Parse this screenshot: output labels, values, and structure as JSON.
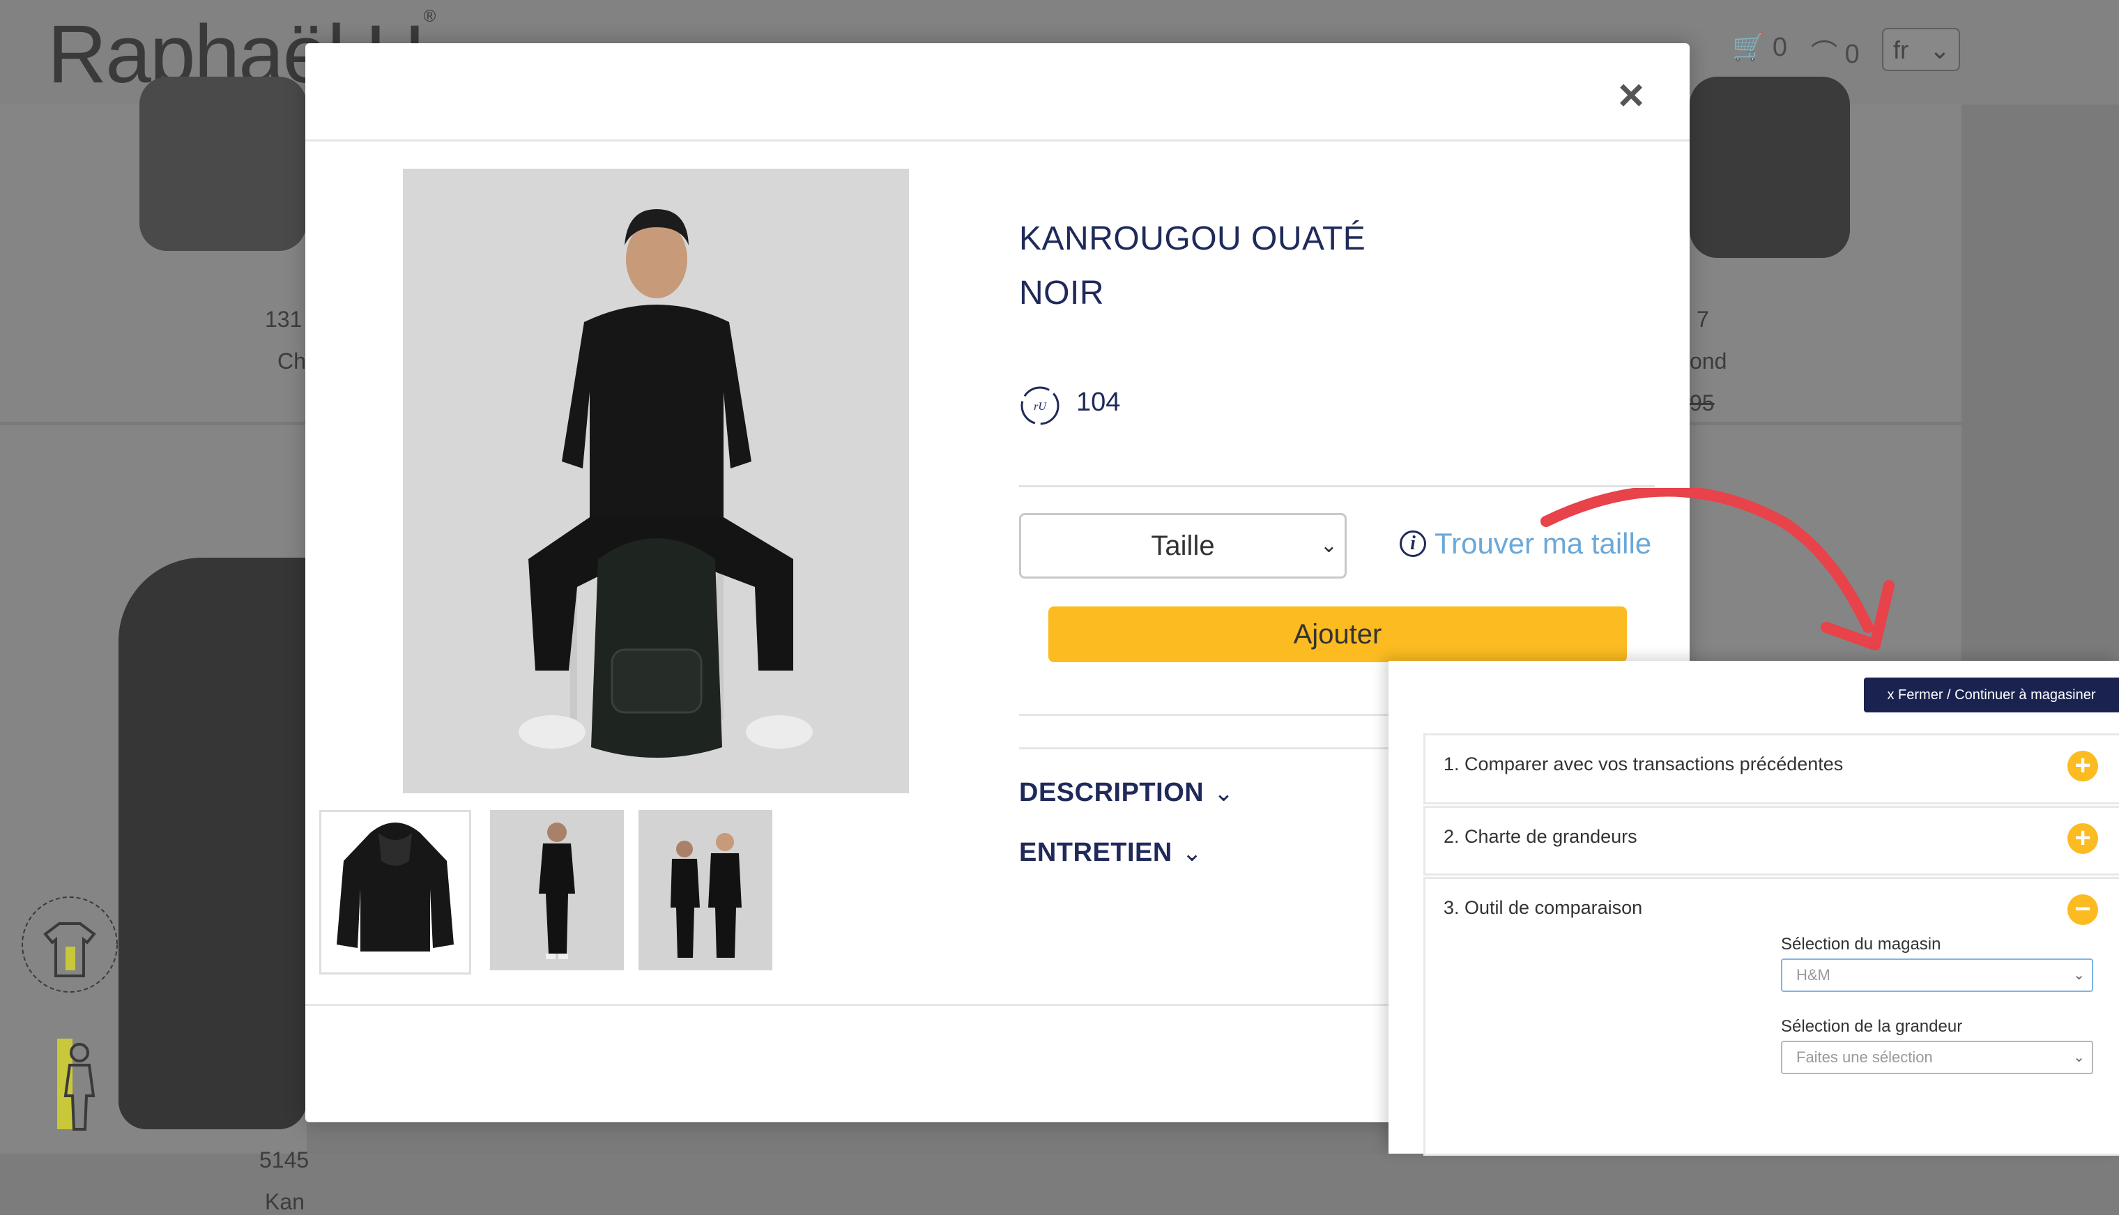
{
  "background": {
    "logo": "Raphaël U",
    "logo_mark": "®",
    "cart_count": "0",
    "wishlist_count": "0",
    "language": "fr",
    "product_left_code": "131",
    "product_left_name": "Ch",
    "product_right_code": "7",
    "product_right_name": "ond",
    "product_right_price": "95",
    "product_bottom_code": "5145",
    "product_bottom_name": "Kan"
  },
  "modal": {
    "close_label": "×",
    "title_line1": "KANROUGOU OUATÉ",
    "title_line2": "NOIR",
    "points": "104",
    "size_select_value": "Taille",
    "find_size_link": "Trouver ma taille",
    "add_button": "Ajouter",
    "accordion_description": "DESCRIPTION",
    "accordion_care": "ENTRETIEN"
  },
  "size_panel": {
    "close_button": "x Fermer / Continuer à magasiner",
    "section1": "1. Comparer avec vos transactions précédentes",
    "section2": "2. Charte de grandeurs",
    "section3": "3. Outil de comparaison",
    "store_label": "Sélection du magasin",
    "store_value": "H&M",
    "size_label": "Sélection de la grandeur",
    "size_placeholder": "Faites une sélection"
  },
  "colors": {
    "navy": "#1f2a5a",
    "accent_yellow": "#fbbb21",
    "link_blue": "#6ba8d8",
    "arrow_red": "#e8424a"
  }
}
